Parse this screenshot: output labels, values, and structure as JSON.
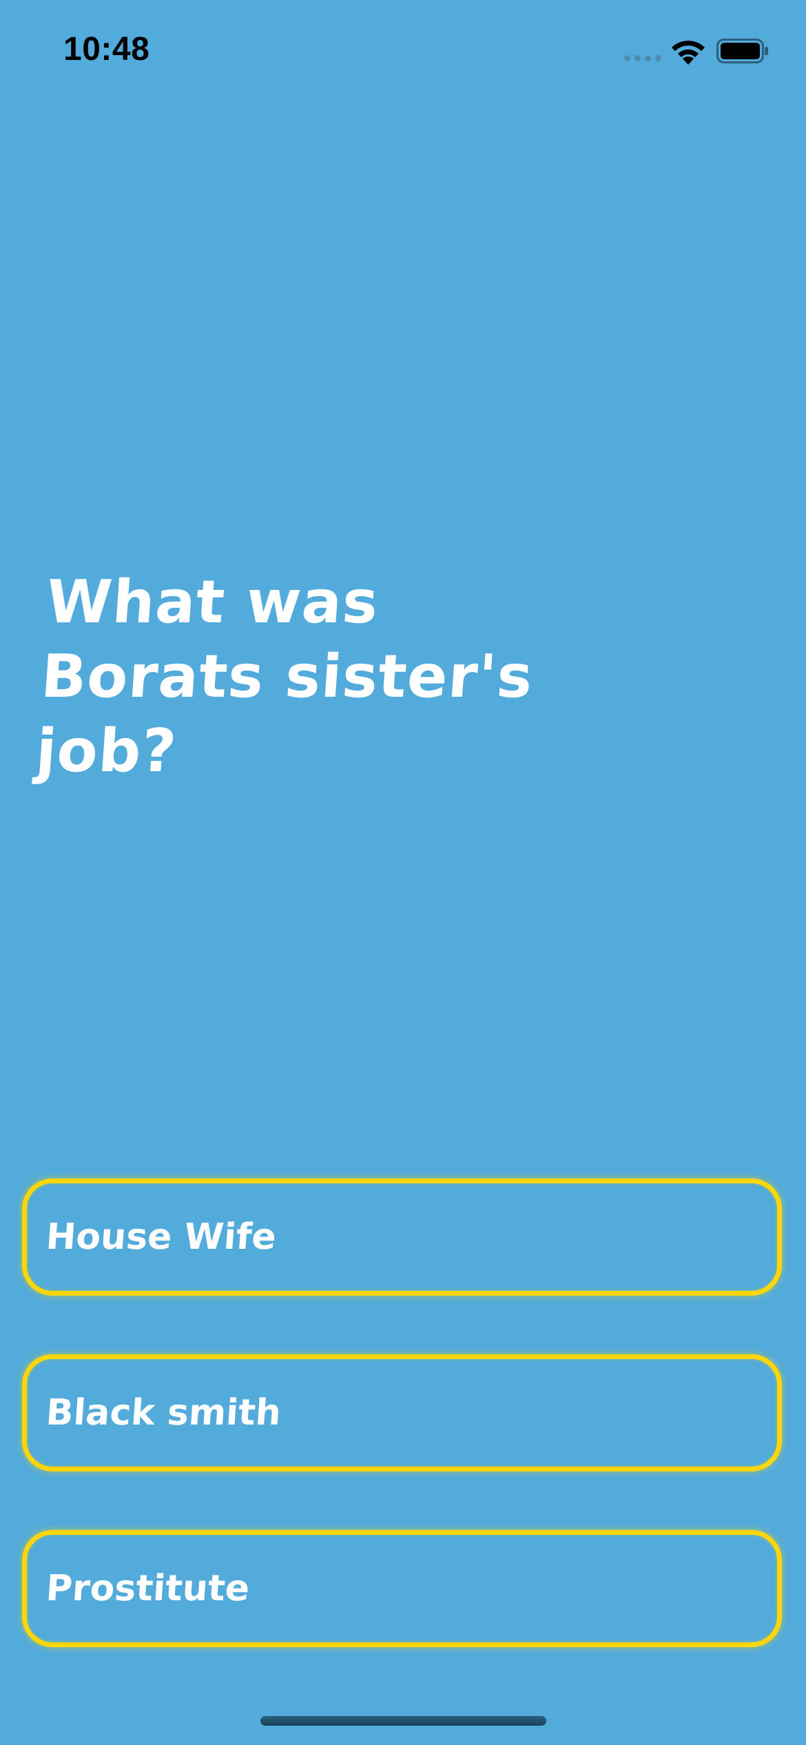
{
  "status_bar": {
    "time": "10:48",
    "signal_icon": "cellular-signal-dots",
    "wifi_icon": "wifi-icon",
    "battery_icon": "battery-full-icon"
  },
  "question": {
    "text": "What was Borats sister's job?"
  },
  "answers": [
    {
      "label": "House Wife"
    },
    {
      "label": "Black smith"
    },
    {
      "label": "Prostitute"
    }
  ],
  "colors": {
    "background": "#52abda",
    "answer_border": "#ffd60a",
    "text": "#ffffff"
  }
}
